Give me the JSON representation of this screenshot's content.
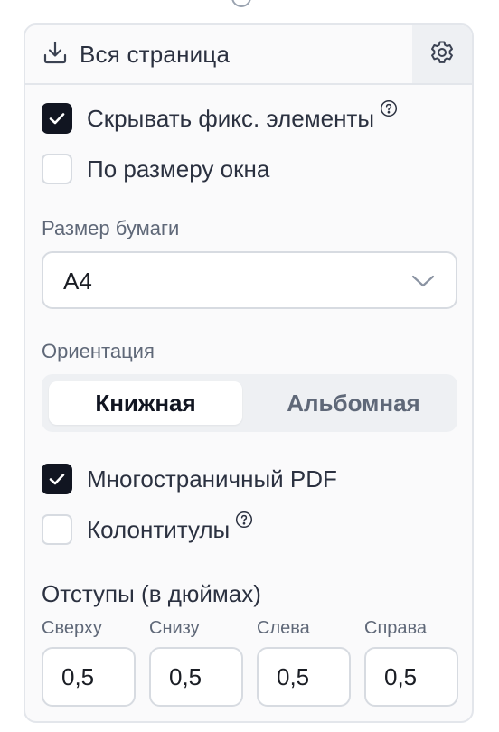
{
  "header": {
    "download_label": "Вся страница",
    "download_icon": "download-icon",
    "settings_icon": "gear-icon"
  },
  "options": {
    "hide_fixed": {
      "label": "Скрывать фикс. элементы",
      "checked": true,
      "help_icon": "help-icon"
    },
    "fit_window": {
      "label": "По размеру окна",
      "checked": false
    }
  },
  "paper": {
    "label": "Размер бумаги",
    "value": "A4"
  },
  "orientation": {
    "label": "Ориентация",
    "options": [
      "Книжная",
      "Альбомная"
    ],
    "selected": "Книжная"
  },
  "pdf": {
    "multipage": {
      "label": "Многостраничный PDF",
      "checked": true
    },
    "headers_footers": {
      "label": "Колонтитулы",
      "checked": false,
      "help_icon": "help-icon"
    }
  },
  "margins": {
    "title": "Отступы (в дюймах)",
    "fields": [
      {
        "label": "Сверху",
        "value": "0,5"
      },
      {
        "label": "Снизу",
        "value": "0,5"
      },
      {
        "label": "Слева",
        "value": "0,5"
      },
      {
        "label": "Справа",
        "value": "0,5"
      }
    ]
  },
  "colors": {
    "checkbox_on": "#111521",
    "border": "#d7dbe1",
    "panel_bg": "#fafafb",
    "segment_bg": "#eef0f3"
  }
}
